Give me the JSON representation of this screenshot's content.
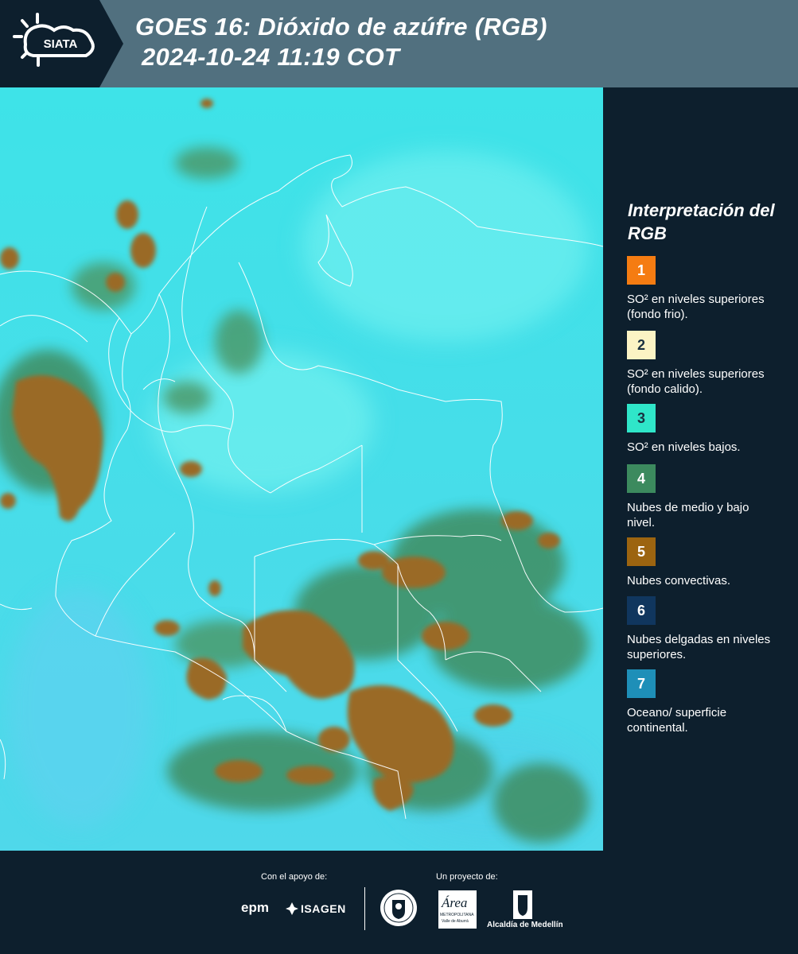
{
  "header": {
    "logo_text": "SIATA",
    "title_line1": "GOES 16: Dióxido de azúfre (RGB)",
    "title_line2": "2024-10-24 11:19 COT"
  },
  "legend": {
    "title": "Interpretación del RGB",
    "items": [
      {
        "number": "1",
        "color": "#f57c12",
        "text": "SO² en niveles superiores (fondo frio)."
      },
      {
        "number": "2",
        "color": "#fbf3c4",
        "text": "SO² en niveles superiores (fondo calido)."
      },
      {
        "number": "3",
        "color": "#2fe6c9",
        "text": "SO² en niveles bajos."
      },
      {
        "number": "4",
        "color": "#3c8a5e",
        "text": "Nubes de medio y bajo nivel."
      },
      {
        "number": "5",
        "color": "#9c6410",
        "text": "Nubes convectivas."
      },
      {
        "number": "6",
        "color": "#10365e",
        "text": "Nubes delgadas en niveles superiores."
      },
      {
        "number": "7",
        "color": "#1e8fb8",
        "text": "Oceano/ superficie continental."
      }
    ]
  },
  "footer": {
    "support_label": "Con el apoyo de:",
    "project_label": "Un proyecto de:",
    "sponsor_1": "epm",
    "sponsor_2": "ISAGEN",
    "partner_area": "Área",
    "partner_area_sub": "METROPOLITANA",
    "partner_area_sub2": "Valle de Aburrá",
    "partner_alcaldia": "Alcaldía de Medellín"
  },
  "colors": {
    "background": "#0d1f2d",
    "header": "#51707f",
    "map_base": "#2ee6e6",
    "convective": "#9c6a2a",
    "mid_cloud": "#3c8a5e"
  }
}
